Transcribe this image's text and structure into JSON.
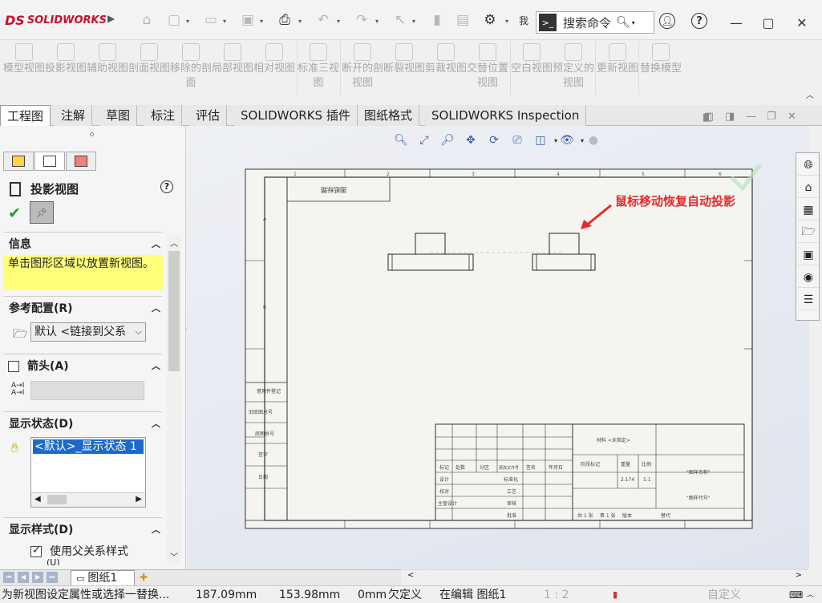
{
  "app": {
    "logo_text": "SOLIDWORKS",
    "logo_mark": "DS"
  },
  "search": {
    "placeholder": "搜索命令"
  },
  "quick_tail": "我",
  "ribbon": {
    "buttons": [
      {
        "label": "模型视图"
      },
      {
        "label": "投影视图"
      },
      {
        "label": "辅助视图"
      },
      {
        "label": "剖面视图"
      },
      {
        "label": "移除的剖面"
      },
      {
        "label": "局部视图"
      },
      {
        "label": "相对视图"
      },
      {
        "label": "标准三视图"
      },
      {
        "label": "断开的剖视图"
      },
      {
        "label": "断裂视图"
      },
      {
        "label": "剪裁视图"
      },
      {
        "label": "交替位置视图"
      },
      {
        "label": "空白视图"
      },
      {
        "label": "预定义的视图"
      },
      {
        "label": "更新视图"
      },
      {
        "label": "替换模型"
      }
    ]
  },
  "tabs": [
    {
      "label": "工程图"
    },
    {
      "label": "注解"
    },
    {
      "label": "草图"
    },
    {
      "label": "标注"
    },
    {
      "label": "评估"
    },
    {
      "label": "SOLIDWORKS 插件"
    },
    {
      "label": "图纸格式"
    },
    {
      "label": "SOLIDWORKS Inspection"
    }
  ],
  "property_manager": {
    "title": "投影视图",
    "info": {
      "header": "信息",
      "text": "单击图形区域以放置新视图。"
    },
    "ref_config": {
      "header": "参考配置(R)",
      "value": "默认 <链接到父系"
    },
    "arrow": {
      "header": "箭头(A)"
    },
    "display_state": {
      "header": "显示状态(D)",
      "selected": "<默认>_显示状态 1"
    },
    "display_style": {
      "header": "显示样式(D)",
      "checkbox_label": "使用父关系样式",
      "checkbox_sub": "(U)"
    }
  },
  "annotation": {
    "text": "鼠标移动恢复自动投影",
    "color": "#e52a2a"
  },
  "drawing": {
    "title_block_label": "图纸标题",
    "col_numbers": [
      "1",
      "2",
      "3",
      "4",
      "5",
      "6"
    ],
    "row_letters": [
      "A",
      "B"
    ],
    "left_strip_labels": [
      "借用件登记",
      "旧底图总号",
      "底图总号",
      "签字",
      "日期"
    ],
    "tb_row_labels": [
      "标记",
      "处数",
      "分区",
      "更改文件号",
      "签名",
      "年月日"
    ],
    "tb_left_labels": [
      "设计",
      "标准化",
      "校对",
      "工艺",
      "主管设计",
      "审核",
      "批准"
    ],
    "tb_right_top": "材料 <未指定>",
    "tb_right_headers": [
      "阶段标记",
      "重量",
      "比例"
    ],
    "tb_weight": "2.174",
    "tb_scale": "1:1",
    "tb_name": "\"图样名称\"",
    "tb_code": "\"图样代号\"",
    "tb_bottom": [
      "共 1 张",
      "第 1 张",
      "版本",
      "替代"
    ]
  },
  "sheet": {
    "tab_label": "图纸1"
  },
  "status": {
    "message": "为新视图设定属性或选择一替换...",
    "x": "187.09mm",
    "y": "153.98mm",
    "z": "0mm",
    "def": "欠定义",
    "editing": "在编辑 图纸1",
    "scale": "1 : 2",
    "units": "自定义"
  }
}
